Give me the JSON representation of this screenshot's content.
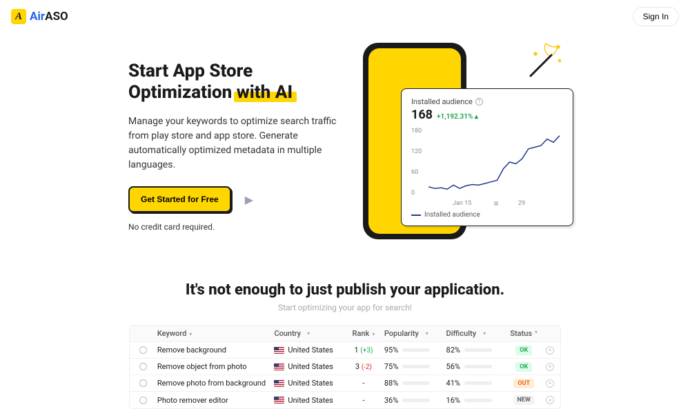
{
  "header": {
    "brand_air": "Air",
    "brand_aso": "ASO",
    "logo_letter": "A",
    "signin": "Sign In"
  },
  "hero": {
    "title_line1": "Start App Store",
    "title_line2a": "Optimization ",
    "title_line2b": "with AI",
    "subtitle": "Manage your keywords to optimize search traffic from play store and app store. Generate automatically optimized metadata in multiple languages.",
    "cta": "Get Started for Free",
    "no_card": "No credit card required."
  },
  "chart_data": {
    "type": "line",
    "title": "Installed audience",
    "value": "168",
    "delta": "+1,192.31%",
    "ylim": [
      0,
      180
    ],
    "y_ticks": [
      0,
      60,
      120,
      180
    ],
    "x_ticks": [
      "Jan 15",
      "29"
    ],
    "legend": "Installed audience",
    "series": [
      {
        "name": "Installed audience",
        "values": [
          15,
          10,
          12,
          8,
          20,
          10,
          18,
          22,
          20,
          25,
          30,
          35,
          70,
          90,
          85,
          100,
          130,
          135,
          140,
          160,
          150,
          170
        ]
      }
    ]
  },
  "section2": {
    "title": "It's not enough to just publish your application.",
    "subtitle": "Start optimizing your app for search!"
  },
  "table": {
    "headers": {
      "keyword": "Keyword",
      "country": "Country",
      "rank": "Rank",
      "popularity": "Popularity",
      "difficulty": "Difficulty",
      "status": "Status"
    },
    "rows": [
      {
        "keyword": "Remove background",
        "country": "United States",
        "rank": "1",
        "rank_delta": "(+3)",
        "rank_delta_sign": "up",
        "popularity": 95,
        "pop_color": "green",
        "difficulty": 82,
        "diff_color": "red",
        "status": "OK",
        "status_class": "ok"
      },
      {
        "keyword": "Remove object from photo",
        "country": "United States",
        "rank": "3",
        "rank_delta": "(-2)",
        "rank_delta_sign": "down",
        "popularity": 75,
        "pop_color": "green",
        "difficulty": 56,
        "diff_color": "yellow",
        "status": "OK",
        "status_class": "ok"
      },
      {
        "keyword": "Remove photo from background",
        "country": "United States",
        "rank": "-",
        "rank_delta": "",
        "rank_delta_sign": "",
        "popularity": 88,
        "pop_color": "green",
        "difficulty": 41,
        "diff_color": "yellow",
        "status": "OUT",
        "status_class": "out"
      },
      {
        "keyword": "Photo remover editor",
        "country": "United States",
        "rank": "-",
        "rank_delta": "",
        "rank_delta_sign": "",
        "popularity": 36,
        "pop_color": "yellow",
        "difficulty": 16,
        "diff_color": "green",
        "status": "NEW",
        "status_class": "new"
      }
    ]
  }
}
